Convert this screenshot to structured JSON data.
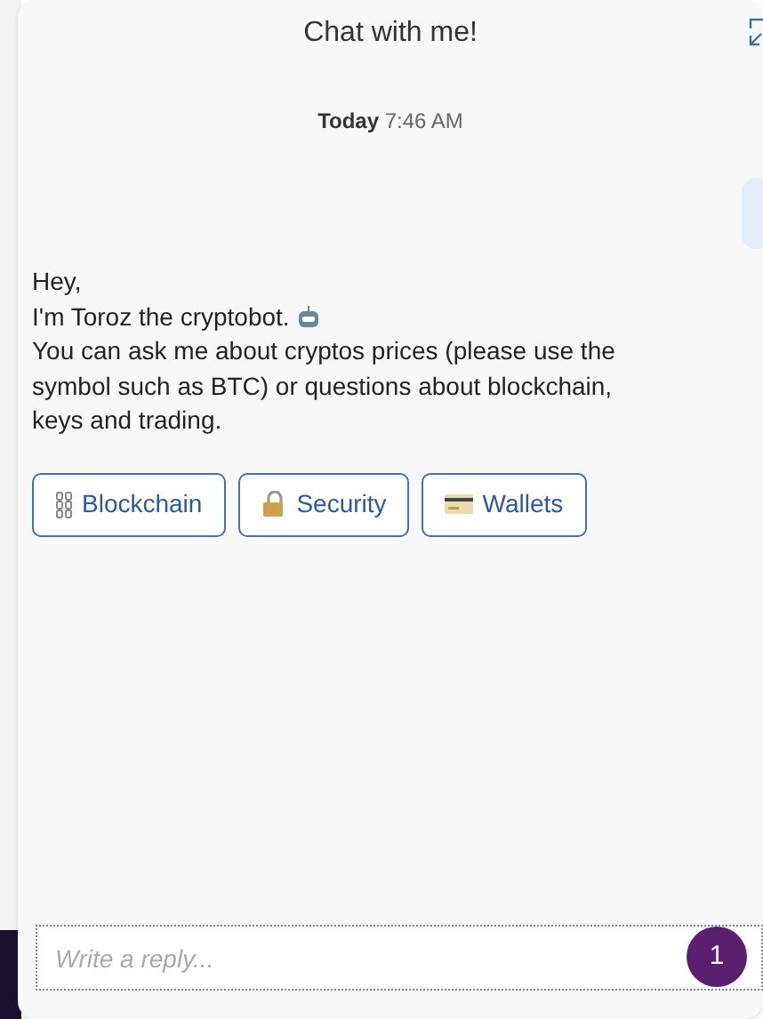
{
  "header": {
    "title": "Chat with me!"
  },
  "timestamp": {
    "day": "Today",
    "time": "7:46 AM"
  },
  "message": {
    "lines": [
      "Hey,",
      "I'm Toroz the cryptobot.",
      "You can ask me about cryptos prices (please use the symbol such as BTC) or questions about blockchain, keys and trading."
    ]
  },
  "quick_replies": [
    {
      "label": "Blockchain",
      "kind": "chain"
    },
    {
      "label": "Security",
      "kind": "lock"
    },
    {
      "label": "Wallets",
      "kind": "card"
    }
  ],
  "composer": {
    "placeholder": "Write a reply...",
    "badge": "1"
  }
}
